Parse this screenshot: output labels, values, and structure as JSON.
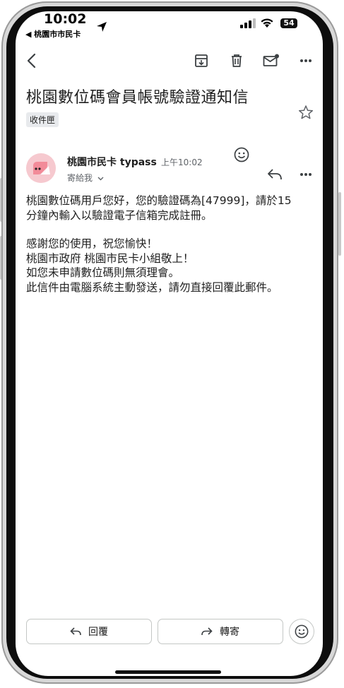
{
  "status_bar": {
    "time": "10:02",
    "back_app": "◀ 桃園市市民卡",
    "battery": "54"
  },
  "toolbar": {
    "back_icon": "chevron-left-icon",
    "archive_icon": "archive-icon",
    "delete_icon": "trash-icon",
    "mark_unread_icon": "mail-unread-icon",
    "more_icon": "more-horizontal-icon"
  },
  "email": {
    "subject": "桃園數位碼會員帳號驗證通知信",
    "label": "收件匣",
    "sender": "桃園市民卡 typass",
    "time": "上午10:02",
    "recipient": "寄給我",
    "body": {
      "line1": "桃園數位碼用戶您好，您的驗證碼為[47999]，請於15",
      "line2": "分鐘內輸入以驗證電子信箱完成註冊。",
      "line3": "感謝您的使用，祝您愉快！",
      "line4": "桃園市政府 桃園市民卡小組敬上！",
      "line5": "如您未申請數位碼則無須理會。",
      "line6": "此信件由電腦系統主動發送，請勿直接回覆此郵件。"
    }
  },
  "actions": {
    "reply_label": "回覆",
    "forward_label": "轉寄"
  },
  "colors": {
    "text": "#1f1f1f",
    "secondary": "#5f6368",
    "chip_bg": "#e8eaed",
    "avatar_bg": "#f6c9cf"
  }
}
